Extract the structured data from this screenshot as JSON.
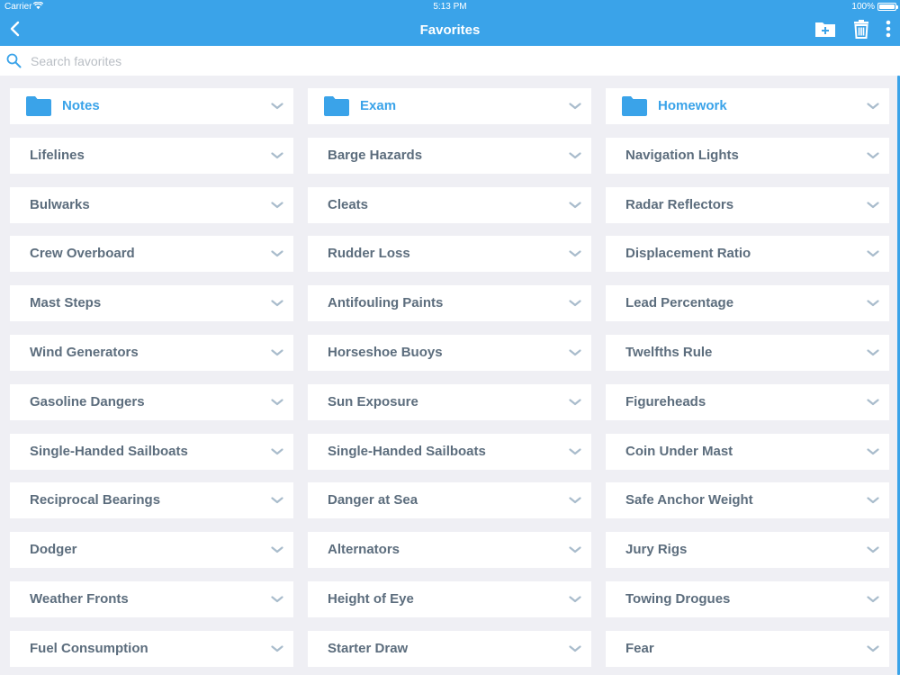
{
  "status": {
    "carrier": "Carrier",
    "time": "5:13 PM",
    "battery": "100%"
  },
  "header": {
    "title": "Favorites"
  },
  "search": {
    "placeholder": "Search favorites",
    "value": ""
  },
  "colors": {
    "accent": "#3aa3e9",
    "background": "#efeff4",
    "item_text": "#5c6d7d",
    "chevron": "#a9bccc"
  },
  "folders": [
    {
      "label": "Notes",
      "icon": "folder-icon"
    },
    {
      "label": "Exam",
      "icon": "folder-icon"
    },
    {
      "label": "Homework",
      "icon": "folder-icon"
    }
  ],
  "items": [
    "Lifelines",
    "Barge Hazards",
    "Navigation Lights",
    "Bulwarks",
    "Cleats",
    "Radar Reflectors",
    "Crew Overboard",
    "Rudder Loss",
    "Displacement Ratio",
    "Mast Steps",
    "Antifouling Paints",
    "Lead Percentage",
    "Wind Generators",
    "Horseshoe Buoys",
    "Twelfths Rule",
    "Gasoline Dangers",
    "Sun Exposure",
    "Figureheads",
    "Single-Handed Sailboats",
    "Single-Handed Sailboats",
    "Coin Under Mast",
    "Reciprocal Bearings",
    "Danger at Sea",
    "Safe Anchor Weight",
    "Dodger",
    "Alternators",
    "Jury Rigs",
    "Weather Fronts",
    "Height of Eye",
    "Towing Drogues",
    "Fuel Consumption",
    "Starter Draw",
    "Fear"
  ]
}
